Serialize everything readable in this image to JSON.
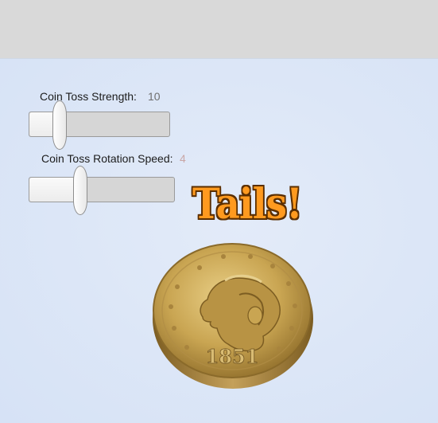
{
  "controls": {
    "strength": {
      "label": "Coin Toss Strength:",
      "value": "10",
      "value_color": "#6e6e6e",
      "level": 0.2
    },
    "rotation": {
      "label": "Coin Toss Rotation Speed:",
      "value": "4",
      "value_color": "#c9a6a6",
      "level": 0.36
    }
  },
  "result": {
    "text": "Tails!",
    "color": "#ff9a1f"
  },
  "coin": {
    "year": "1851",
    "icon": "gold-liberty-head-coin-icon"
  }
}
